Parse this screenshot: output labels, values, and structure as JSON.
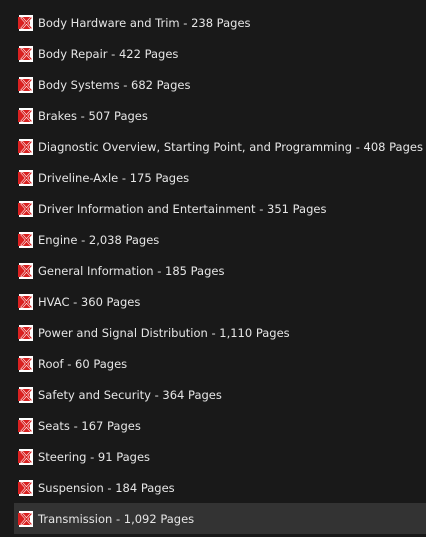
{
  "files": [
    {
      "label": "Body Hardware and Trim - 238 Pages",
      "icon": "pdf-file-icon",
      "selected": false
    },
    {
      "label": "Body Repair - 422 Pages",
      "icon": "pdf-file-icon",
      "selected": false
    },
    {
      "label": "Body Systems - 682 Pages",
      "icon": "pdf-file-icon",
      "selected": false
    },
    {
      "label": "Brakes - 507 Pages",
      "icon": "pdf-file-icon",
      "selected": false
    },
    {
      "label": "Diagnostic Overview, Starting Point, and Programming - 408 Pages",
      "icon": "pdf-file-icon",
      "selected": false
    },
    {
      "label": "Driveline-Axle - 175 Pages",
      "icon": "pdf-file-icon",
      "selected": false
    },
    {
      "label": "Driver Information and Entertainment - 351 Pages",
      "icon": "pdf-file-icon",
      "selected": false
    },
    {
      "label": "Engine - 2,038 Pages",
      "icon": "pdf-file-icon",
      "selected": false
    },
    {
      "label": "General Information - 185 Pages",
      "icon": "pdf-file-icon",
      "selected": false
    },
    {
      "label": "HVAC - 360 Pages",
      "icon": "pdf-file-icon",
      "selected": false
    },
    {
      "label": "Power and Signal Distribution - 1,110 Pages",
      "icon": "pdf-file-icon",
      "selected": false
    },
    {
      "label": "Roof - 60 Pages",
      "icon": "pdf-file-icon",
      "selected": false
    },
    {
      "label": "Safety and Security - 364 Pages",
      "icon": "pdf-file-icon",
      "selected": false
    },
    {
      "label": "Seats - 167 Pages",
      "icon": "pdf-file-icon",
      "selected": false
    },
    {
      "label": "Steering - 91 Pages",
      "icon": "pdf-file-icon",
      "selected": false
    },
    {
      "label": "Suspension - 184 Pages",
      "icon": "pdf-file-icon",
      "selected": false
    },
    {
      "label": "Transmission - 1,092 Pages",
      "icon": "pdf-file-icon",
      "selected": true
    }
  ],
  "colors": {
    "background": "#191919",
    "selected_row": "#333333",
    "text": "#e6e6e6",
    "icon_red": "#d92121"
  }
}
